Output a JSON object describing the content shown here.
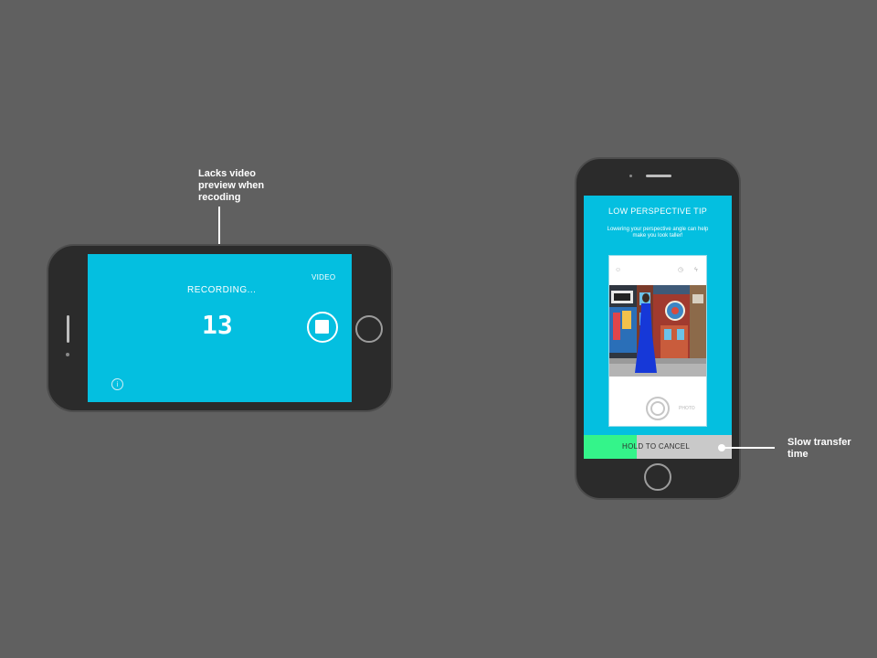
{
  "annotations": {
    "video_preview": "Lacks video\npreview when\nrecoding",
    "transfer": "Slow transfer\ntime"
  },
  "recording_screen": {
    "status_label": "RECORDING...",
    "mode_label": "VIDEO",
    "counter": "13",
    "info_glyph": "i",
    "screen_color": "#04bfe0"
  },
  "tip_screen": {
    "title": "LOW PERSPECTIVE TIP",
    "description": "Lowering your perspective angle can help make you look taller!",
    "photo_mode_label": "PHOTO",
    "cancel_label": "HOLD TO CANCEL",
    "cancel_progress": 0.36,
    "progress_color": "#34f48a"
  },
  "icons": [
    "info-icon",
    "stop-icon",
    "smiley-icon",
    "timer-icon",
    "flash-icon",
    "shutter-icon"
  ]
}
